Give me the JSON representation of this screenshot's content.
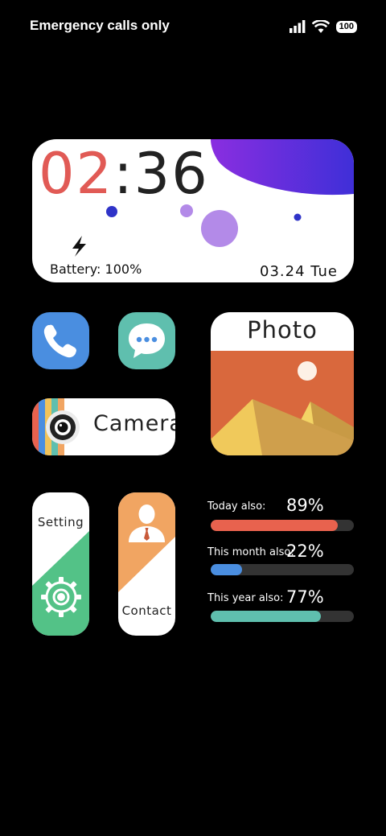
{
  "status_bar": {
    "carrier_text": "Emergency calls only",
    "icons": [
      "signal-icon",
      "wifi-icon"
    ],
    "battery_level": "100"
  },
  "clock_widget": {
    "hours": "02",
    "separator": ":",
    "minutes": "36",
    "battery_text": "Battery: 100%",
    "date_text": "03.24  Tue",
    "accent_color": "#e15a55",
    "blob_color": "#6a2fd6"
  },
  "apps": {
    "phone": {
      "icon": "phone-icon",
      "color": "#4a8ee0"
    },
    "messages": {
      "icon": "chat-bubble-icon",
      "color": "#5fbfae"
    },
    "camera": {
      "label": "Camera",
      "icon": "camera-lens-icon"
    },
    "photo": {
      "label": "Photo",
      "icon": "landscape-icon",
      "color": "#d9683d"
    },
    "setting": {
      "label": "Setting",
      "icon": "gear-icon",
      "color": "#53c287"
    },
    "contact": {
      "label": "Contact",
      "icon": "person-icon",
      "color": "#f1a562"
    }
  },
  "progress": [
    {
      "label": "Today also:",
      "percent_text": "89%",
      "value": 89,
      "color": "#e8624e"
    },
    {
      "label": "This month also:",
      "percent_text": "22%",
      "value": 22,
      "color": "#4a8ee0"
    },
    {
      "label": "This year also:",
      "percent_text": "77%",
      "value": 77,
      "color": "#5fbfae"
    }
  ]
}
